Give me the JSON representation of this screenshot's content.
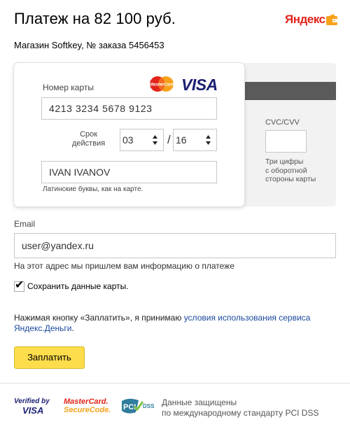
{
  "header": {
    "title": "Платеж на 82 100 руб.",
    "logo_text": "Яндекс",
    "order_info": "Магазин Softkey, № заказа 5456453"
  },
  "card": {
    "number_label": "Номер карты",
    "mastercard_text": "MasterCard",
    "visa_text": "VISA",
    "number_value": "4213  3234  5678  9123",
    "expiry_label_line1": "Срок",
    "expiry_label_line2": "действия",
    "month": "03",
    "separator": "/",
    "year": "16",
    "holder_value": "IVAN IVANOV",
    "holder_hint": "Латинские буквы, как на карте.",
    "cvc_label": "CVC/CVV",
    "cvc_value": "",
    "cvc_hint_lines": [
      "Три цифры",
      "с оборотной",
      "стороны карты"
    ]
  },
  "email": {
    "label": "Email",
    "value": "user@yandex.ru",
    "hint": "На этот адрес мы пришлем вам информацию о платеже"
  },
  "save_card": {
    "checked": true,
    "label": "Сохранить данные карты."
  },
  "terms": {
    "prefix": "Нажимая кнопку «Заплатить», я принимаю ",
    "link": "условия использования сервиса Яндекс.Деньги",
    "suffix": "."
  },
  "pay_button": {
    "label": "Заплатить"
  },
  "footer": {
    "vbv_line1": "Verified by",
    "vbv_line2": "VISA",
    "mc_line1": "MasterCard.",
    "mc_line2": "SecureCode.",
    "pci_text": "PCI",
    "pci_dss": "DSS",
    "secure_line1": "Данные защищены",
    "secure_line2": "по международному стандарту PCI DSS"
  },
  "colors": {
    "accent_button": "#fddd4b",
    "brand_red": "#e2231a",
    "link": "#1a4aa0",
    "visa_blue": "#1a1f71"
  },
  "icons": [
    "yandex-wallet-icon",
    "mastercard-icon",
    "visa-icon",
    "select-arrows-icon",
    "checkmark-icon",
    "pci-dss-icon"
  ]
}
